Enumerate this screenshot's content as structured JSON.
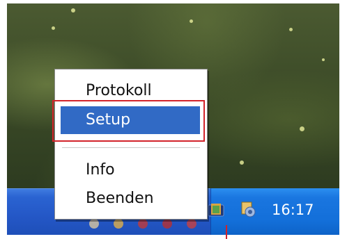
{
  "context_menu": {
    "items": [
      {
        "label": "Protokoll",
        "selected": false
      },
      {
        "label": "Setup",
        "selected": true
      },
      {
        "label": "Info",
        "selected": false
      },
      {
        "label": "Beenden",
        "selected": false
      }
    ]
  },
  "taskbar": {
    "clock": "16:17",
    "tray_icons": [
      "app-tray-icon",
      "network-tray-icon"
    ]
  },
  "colors": {
    "selection": "#316ac5",
    "highlight_frame": "#d2232a",
    "taskbar": "#2457c6"
  }
}
